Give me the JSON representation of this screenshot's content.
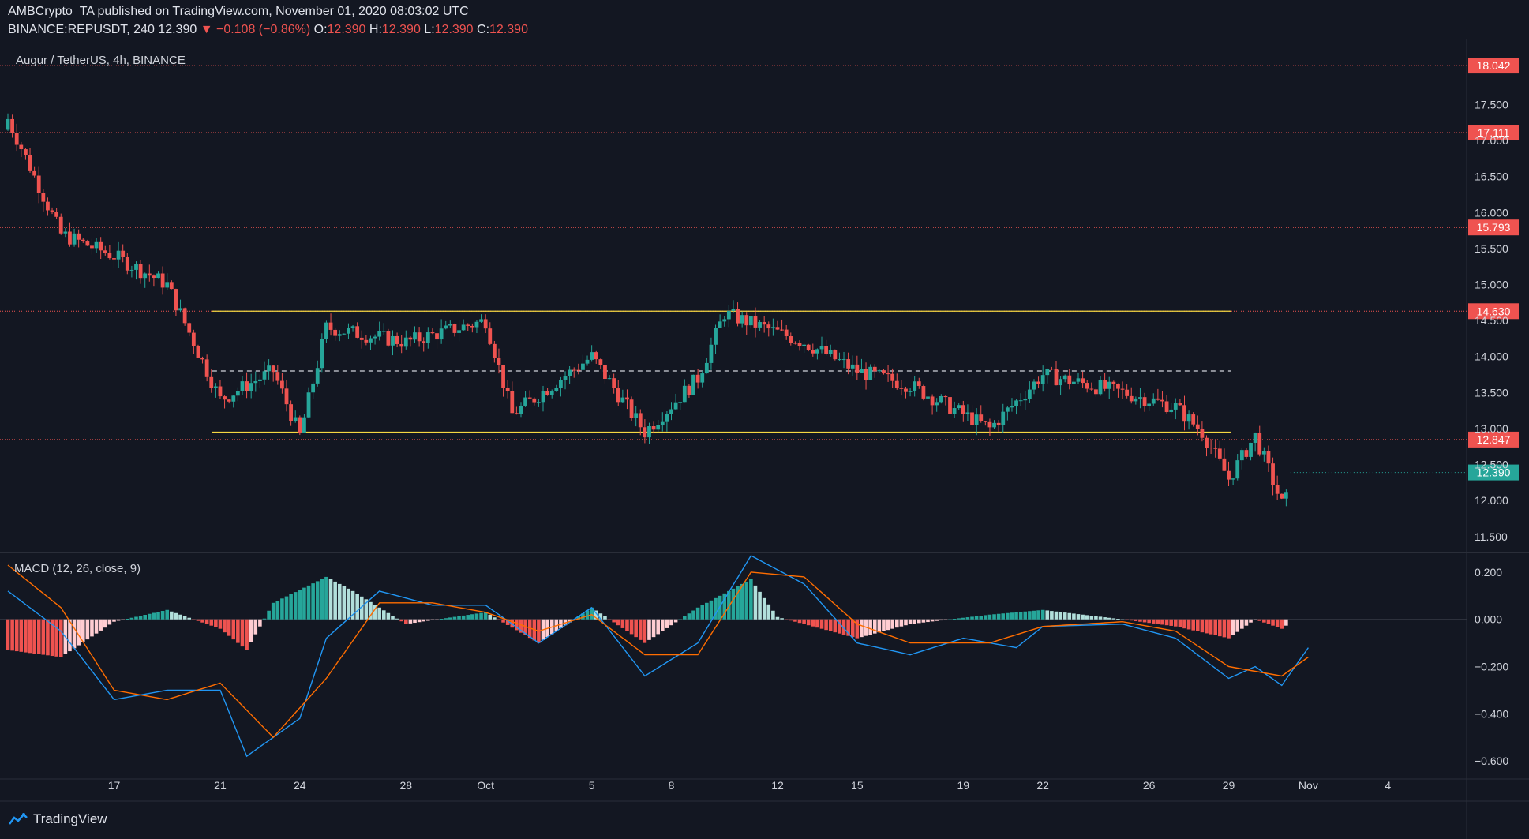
{
  "header": {
    "line1": "AMBCrypto_TA published on TradingView.com, November 01, 2020 08:03:02 UTC",
    "symbol": "BINANCE:REPUSDT, 240",
    "last": "12.390",
    "change": "▼ −0.108 (−0.86%)",
    "o_label": "O:",
    "o": "12.390",
    "h_label": "H:",
    "h": "12.390",
    "l_label": "L:",
    "l": "12.390",
    "c_label": "C:",
    "c": "12.390"
  },
  "price_pane_title": "Augur / TetherUS, 4h, BINANCE",
  "macd_pane_title": "MACD (12, 26, close, 9)",
  "footer": {
    "brand": "TradingView",
    "icon": "tradingview-logo-icon"
  },
  "colors": {
    "background": "#131722",
    "up": "#26a69a",
    "down": "#ef5350",
    "channel": "#f5d742",
    "macd_line": "#2196f3",
    "signal_line": "#ff6d00",
    "hist_up_strong": "#26a69a",
    "hist_up_weak": "#b2dfdb",
    "hist_down_strong": "#ef5350",
    "hist_down_weak": "#ffcdd2"
  },
  "chart_data": [
    {
      "type": "candlestick",
      "title": "Augur / TetherUS, 4h, BINANCE",
      "x_ticks": [
        "17",
        "21",
        "24",
        "28",
        "Oct",
        "5",
        "8",
        "12",
        "15",
        "19",
        "22",
        "26",
        "29",
        "Nov",
        "4"
      ],
      "y_ticks": [
        "17.500",
        "17.000",
        "16.500",
        "16.000",
        "15.500",
        "15.000",
        "14.500",
        "14.000",
        "13.500",
        "13.000",
        "12.500",
        "12.000",
        "11.500"
      ],
      "ylim": [
        11.3,
        18.35
      ],
      "horizontal_levels": [
        {
          "value": 18.042,
          "label": "18.042",
          "style": "dotted-red"
        },
        {
          "value": 17.111,
          "label": "17.111",
          "style": "dotted-red"
        },
        {
          "value": 15.793,
          "label": "15.793",
          "style": "dotted-red"
        },
        {
          "value": 14.63,
          "label": "14.630",
          "style": "dotted-red"
        },
        {
          "value": 12.847,
          "label": "12.847",
          "style": "dotted-red"
        }
      ],
      "channel": {
        "upper": 14.63,
        "mid": 13.8,
        "lower": 12.95,
        "from_date": "Sep 20",
        "to_date": "Oct 29"
      },
      "last_price": {
        "value": 12.39,
        "label": "12.390"
      },
      "approx_close_path": [
        {
          "date": "Sep 13",
          "close": 17.3
        },
        {
          "date": "Sep 14",
          "close": 16.5
        },
        {
          "date": "Sep 15",
          "close": 15.7
        },
        {
          "date": "Sep 17",
          "close": 15.4
        },
        {
          "date": "Sep 19",
          "close": 15.0
        },
        {
          "date": "Sep 21",
          "close": 13.4
        },
        {
          "date": "Sep 23",
          "close": 13.8
        },
        {
          "date": "Sep 24",
          "close": 12.9
        },
        {
          "date": "Sep 25",
          "close": 14.4
        },
        {
          "date": "Sep 28",
          "close": 14.2
        },
        {
          "date": "Oct 1",
          "close": 14.5
        },
        {
          "date": "Oct 2",
          "close": 13.2
        },
        {
          "date": "Oct 5",
          "close": 14.0
        },
        {
          "date": "Oct 7",
          "close": 12.95
        },
        {
          "date": "Oct 9",
          "close": 13.7
        },
        {
          "date": "Oct 10",
          "close": 14.6
        },
        {
          "date": "Oct 13",
          "close": 14.2
        },
        {
          "date": "Oct 15",
          "close": 13.8
        },
        {
          "date": "Oct 17",
          "close": 13.6
        },
        {
          "date": "Oct 20",
          "close": 13.0
        },
        {
          "date": "Oct 22",
          "close": 13.75
        },
        {
          "date": "Oct 25",
          "close": 13.5
        },
        {
          "date": "Oct 27",
          "close": 13.3
        },
        {
          "date": "Oct 28",
          "close": 12.95
        },
        {
          "date": "Oct 29",
          "close": 12.3
        },
        {
          "date": "Oct 30",
          "close": 12.9
        },
        {
          "date": "Oct 31",
          "close": 11.95
        },
        {
          "date": "Nov 1",
          "close": 12.39
        }
      ]
    },
    {
      "type": "macd",
      "title": "MACD (12, 26, close, 9)",
      "y_ticks": [
        "0.200",
        "0.000",
        "−0.200",
        "−0.400",
        "−0.600"
      ],
      "ylim": [
        -0.66,
        0.25
      ],
      "macd_line": [
        {
          "date": "Sep 13",
          "value": 0.12
        },
        {
          "date": "Sep 15",
          "value": -0.05
        },
        {
          "date": "Sep 17",
          "value": -0.34
        },
        {
          "date": "Sep 19",
          "value": -0.3
        },
        {
          "date": "Sep 21",
          "value": -0.3
        },
        {
          "date": "Sep 22",
          "value": -0.58
        },
        {
          "date": "Sep 24",
          "value": -0.42
        },
        {
          "date": "Sep 25",
          "value": -0.08
        },
        {
          "date": "Sep 27",
          "value": 0.12
        },
        {
          "date": "Sep 29",
          "value": 0.06
        },
        {
          "date": "Oct 1",
          "value": 0.06
        },
        {
          "date": "Oct 3",
          "value": -0.1
        },
        {
          "date": "Oct 5",
          "value": 0.05
        },
        {
          "date": "Oct 7",
          "value": -0.24
        },
        {
          "date": "Oct 9",
          "value": -0.1
        },
        {
          "date": "Oct 11",
          "value": 0.27
        },
        {
          "date": "Oct 13",
          "value": 0.15
        },
        {
          "date": "Oct 15",
          "value": -0.1
        },
        {
          "date": "Oct 17",
          "value": -0.15
        },
        {
          "date": "Oct 19",
          "value": -0.08
        },
        {
          "date": "Oct 21",
          "value": -0.12
        },
        {
          "date": "Oct 22",
          "value": -0.03
        },
        {
          "date": "Oct 25",
          "value": -0.02
        },
        {
          "date": "Oct 27",
          "value": -0.08
        },
        {
          "date": "Oct 29",
          "value": -0.25
        },
        {
          "date": "Oct 30",
          "value": -0.2
        },
        {
          "date": "Oct 31",
          "value": -0.28
        },
        {
          "date": "Nov 1",
          "value": -0.12
        }
      ],
      "signal_line": [
        {
          "date": "Sep 13",
          "value": 0.23
        },
        {
          "date": "Sep 15",
          "value": 0.05
        },
        {
          "date": "Sep 17",
          "value": -0.3
        },
        {
          "date": "Sep 19",
          "value": -0.34
        },
        {
          "date": "Sep 21",
          "value": -0.27
        },
        {
          "date": "Sep 23",
          "value": -0.5
        },
        {
          "date": "Sep 25",
          "value": -0.25
        },
        {
          "date": "Sep 27",
          "value": 0.07
        },
        {
          "date": "Sep 29",
          "value": 0.07
        },
        {
          "date": "Oct 1",
          "value": 0.03
        },
        {
          "date": "Oct 3",
          "value": -0.05
        },
        {
          "date": "Oct 5",
          "value": 0.02
        },
        {
          "date": "Oct 7",
          "value": -0.15
        },
        {
          "date": "Oct 9",
          "value": -0.15
        },
        {
          "date": "Oct 11",
          "value": 0.2
        },
        {
          "date": "Oct 13",
          "value": 0.18
        },
        {
          "date": "Oct 15",
          "value": -0.02
        },
        {
          "date": "Oct 17",
          "value": -0.1
        },
        {
          "date": "Oct 20",
          "value": -0.1
        },
        {
          "date": "Oct 22",
          "value": -0.03
        },
        {
          "date": "Oct 25",
          "value": -0.01
        },
        {
          "date": "Oct 27",
          "value": -0.05
        },
        {
          "date": "Oct 29",
          "value": -0.2
        },
        {
          "date": "Oct 30",
          "value": -0.22
        },
        {
          "date": "Oct 31",
          "value": -0.24
        },
        {
          "date": "Nov 1",
          "value": -0.16
        }
      ],
      "histogram_profile": [
        {
          "date": "Sep 13",
          "value": -0.13
        },
        {
          "date": "Sep 15",
          "value": -0.16
        },
        {
          "date": "Sep 17",
          "value": -0.01
        },
        {
          "date": "Sep 19",
          "value": 0.04
        },
        {
          "date": "Sep 21",
          "value": -0.04
        },
        {
          "date": "Sep 22",
          "value": -0.13
        },
        {
          "date": "Sep 23",
          "value": 0.07
        },
        {
          "date": "Sep 25",
          "value": 0.18
        },
        {
          "date": "Sep 26",
          "value": 0.12
        },
        {
          "date": "Sep 28",
          "value": -0.02
        },
        {
          "date": "Oct 1",
          "value": 0.03
        },
        {
          "date": "Oct 3",
          "value": -0.1
        },
        {
          "date": "Oct 5",
          "value": 0.05
        },
        {
          "date": "Oct 7",
          "value": -0.1
        },
        {
          "date": "Oct 9",
          "value": 0.05
        },
        {
          "date": "Oct 11",
          "value": 0.17
        },
        {
          "date": "Oct 12",
          "value": 0.01
        },
        {
          "date": "Oct 15",
          "value": -0.08
        },
        {
          "date": "Oct 17",
          "value": -0.02
        },
        {
          "date": "Oct 20",
          "value": 0.02
        },
        {
          "date": "Oct 22",
          "value": 0.04
        },
        {
          "date": "Oct 25",
          "value": 0.0
        },
        {
          "date": "Oct 27",
          "value": -0.03
        },
        {
          "date": "Oct 29",
          "value": -0.08
        },
        {
          "date": "Oct 30",
          "value": 0.0
        },
        {
          "date": "Oct 31",
          "value": -0.04
        },
        {
          "date": "Nov 1",
          "value": 0.04
        }
      ]
    }
  ]
}
